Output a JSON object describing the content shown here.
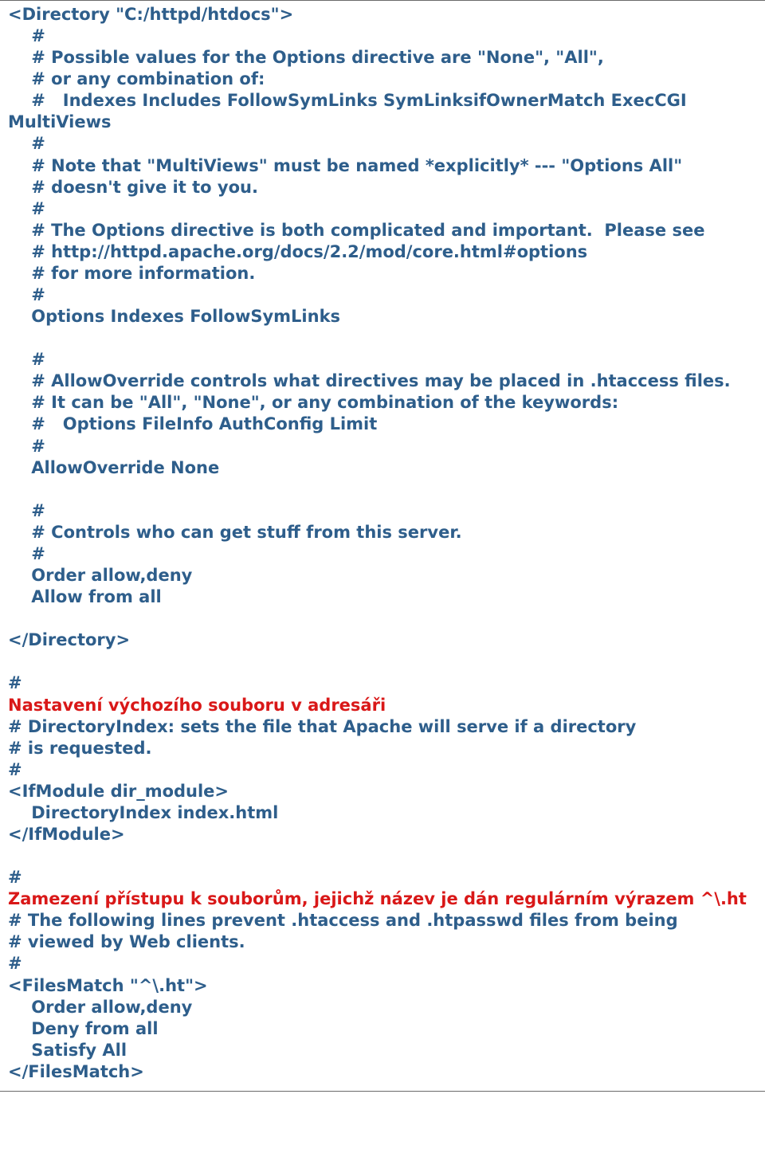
{
  "blocks": [
    {
      "type": "blue",
      "text": "<Directory \"C:/httpd/htdocs\">"
    },
    {
      "type": "blue",
      "text": "    #"
    },
    {
      "type": "blue",
      "text": "    # Possible values for the Options directive are \"None\", \"All\","
    },
    {
      "type": "blue",
      "text": "    # or any combination of:"
    },
    {
      "type": "blue",
      "text": "    #   Indexes Includes FollowSymLinks SymLinksifOwnerMatch ExecCGI MultiViews"
    },
    {
      "type": "blue",
      "text": "    #"
    },
    {
      "type": "blue",
      "text": "    # Note that \"MultiViews\" must be named *explicitly* --- \"Options All\""
    },
    {
      "type": "blue",
      "text": "    # doesn't give it to you."
    },
    {
      "type": "blue",
      "text": "    #"
    },
    {
      "type": "blue",
      "text": "    # The Options directive is both complicated and important.  Please see"
    },
    {
      "type": "blue",
      "text": "    # http://httpd.apache.org/docs/2.2/mod/core.html#options"
    },
    {
      "type": "blue",
      "text": "    # for more information."
    },
    {
      "type": "blue",
      "text": "    #"
    },
    {
      "type": "blue",
      "text": "    Options Indexes FollowSymLinks"
    },
    {
      "type": "blue",
      "text": ""
    },
    {
      "type": "blue",
      "text": "    #"
    },
    {
      "type": "blue",
      "text": "    # AllowOverride controls what directives may be placed in .htaccess files."
    },
    {
      "type": "blue",
      "text": "    # It can be \"All\", \"None\", or any combination of the keywords:"
    },
    {
      "type": "blue",
      "text": "    #   Options FileInfo AuthConfig Limit"
    },
    {
      "type": "blue",
      "text": "    #"
    },
    {
      "type": "blue",
      "text": "    AllowOverride None"
    },
    {
      "type": "blue",
      "text": ""
    },
    {
      "type": "blue",
      "text": "    #"
    },
    {
      "type": "blue",
      "text": "    # Controls who can get stuff from this server."
    },
    {
      "type": "blue",
      "text": "    #"
    },
    {
      "type": "blue",
      "text": "    Order allow,deny"
    },
    {
      "type": "blue",
      "text": "    Allow from all"
    },
    {
      "type": "blue",
      "text": ""
    },
    {
      "type": "blue",
      "text": "</Directory>"
    },
    {
      "type": "blue",
      "text": ""
    },
    {
      "type": "blue",
      "text": "#"
    },
    {
      "type": "red",
      "text": "Nastavení výchozího souboru v adresáři"
    },
    {
      "type": "blue",
      "text": "# DirectoryIndex: sets the file that Apache will serve if a directory"
    },
    {
      "type": "blue",
      "text": "# is requested."
    },
    {
      "type": "blue",
      "text": "#"
    },
    {
      "type": "blue",
      "text": "<IfModule dir_module>"
    },
    {
      "type": "blue",
      "text": "    DirectoryIndex index.html"
    },
    {
      "type": "blue",
      "text": "</IfModule>"
    },
    {
      "type": "blue",
      "text": ""
    },
    {
      "type": "blue",
      "text": "#"
    },
    {
      "type": "red",
      "text": "Zamezení přístupu k souborům, jejichž název je dán regulárním výrazem ^\\.ht"
    },
    {
      "type": "blue",
      "text": "# The following lines prevent .htaccess and .htpasswd files from being"
    },
    {
      "type": "blue",
      "text": "# viewed by Web clients."
    },
    {
      "type": "blue",
      "text": "#"
    },
    {
      "type": "blue",
      "text": "<FilesMatch \"^\\.ht\">"
    },
    {
      "type": "blue",
      "text": "    Order allow,deny"
    },
    {
      "type": "blue",
      "text": "    Deny from all"
    },
    {
      "type": "blue",
      "text": "    Satisfy All"
    },
    {
      "type": "blue",
      "text": "</FilesMatch>"
    }
  ]
}
